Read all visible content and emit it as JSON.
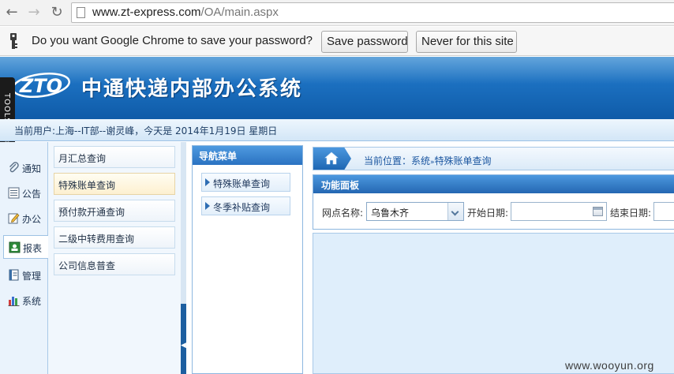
{
  "browser": {
    "url_host": "www.zt-express.com",
    "url_path": "/OA/main.aspx"
  },
  "infobar": {
    "message": "Do you want Google Chrome to save your password?",
    "save_label": "Save password",
    "never_label": "Never for this site"
  },
  "app": {
    "logo_text": "ZTO",
    "title": "中通快递内部办公系统",
    "tools_label": "TOOLS",
    "user_info": "当前用户:上海--IT部--谢灵峰，今天是 2014年1月19日 星期日"
  },
  "left_nav": {
    "items": [
      {
        "label": "通知",
        "icon": "paperclip-icon"
      },
      {
        "label": "公告",
        "icon": "list-icon"
      },
      {
        "label": "办公",
        "icon": "edit-icon"
      },
      {
        "label": "报表",
        "icon": "report-icon",
        "active": true
      },
      {
        "label": "管理",
        "icon": "document-icon"
      },
      {
        "label": "系统",
        "icon": "bar-chart-icon"
      }
    ]
  },
  "sub_menu": {
    "items": [
      {
        "label": "月汇总查询"
      },
      {
        "label": "特殊账单查询",
        "active": true
      },
      {
        "label": "预付款开通查询"
      },
      {
        "label": "二级中转费用查询"
      },
      {
        "label": "公司信息普查"
      }
    ]
  },
  "nav_panel": {
    "title": "导航菜单",
    "links": [
      {
        "label": "特殊账单查询"
      },
      {
        "label": "冬季补贴查询"
      }
    ]
  },
  "main": {
    "breadcrumb": {
      "prefix": "当前位置：",
      "section": "系统",
      "separator": "»",
      "page": "特殊账单查询"
    },
    "func_panel": {
      "title": "功能面板",
      "branch_label": "网点名称:",
      "branch_value": "乌鲁木齐",
      "start_label": "开始日期:",
      "end_label": "结束日期:"
    }
  },
  "watermark": "www.wooyun.org",
  "colors": {
    "banner": "#1b6fbf",
    "panel_header": "#2a72c1",
    "grid_bg": "#dfeefb"
  }
}
